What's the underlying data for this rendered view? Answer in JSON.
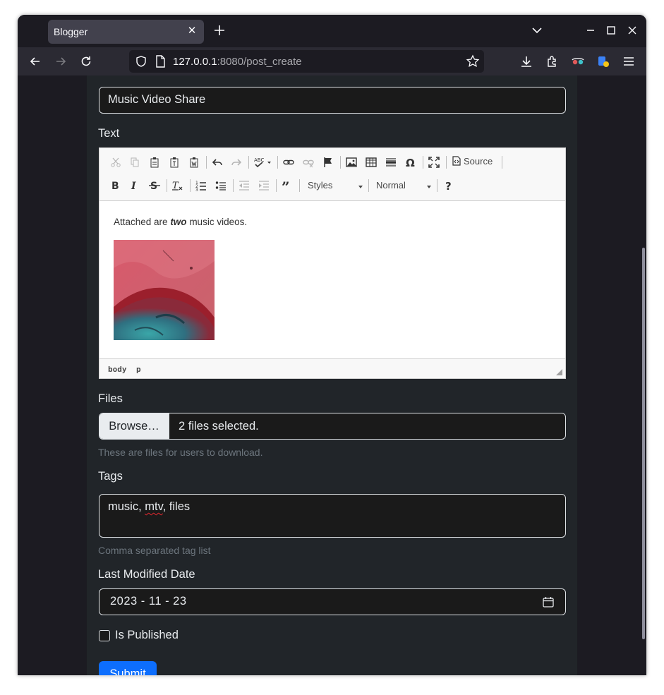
{
  "browser": {
    "tab_title": "Blogger",
    "url_host": "127.0.0.1",
    "url_rest": ":8080/post_create"
  },
  "form": {
    "title_value": "Music Video Share",
    "text_label": "Text",
    "editor": {
      "toolbar_source_label": "Source",
      "styles_label": "Styles",
      "format_label": "Normal",
      "content_before": "Attached are ",
      "content_bold": "two",
      "content_after": " music videos.",
      "path": [
        "body",
        "p"
      ]
    },
    "files_label": "Files",
    "browse_label": "Browse…",
    "files_status": "2 files selected.",
    "files_hint": "These are files for users to download.",
    "tags_label": "Tags",
    "tags_value_pre": "music, ",
    "tags_value_misspelled": "mtv",
    "tags_value_post": ", files",
    "tags_hint": "Comma separated tag list",
    "date_label": "Last Modified Date",
    "date_value": "2023 - 11 - 23",
    "published_label": "Is Published",
    "submit_label": "Submit"
  },
  "colors": {
    "page_bg": "#212529",
    "accent": "#0d6efd",
    "browser_bg": "#1c1b22"
  }
}
